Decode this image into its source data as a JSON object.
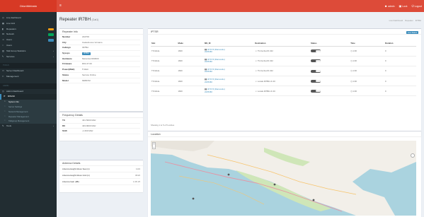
{
  "app": {
    "brand": "OrionWebmin"
  },
  "topnav": [
    {
      "icon": "user-icon",
      "label": "admin"
    },
    {
      "icon": "lock-icon",
      "label": "Lock"
    },
    {
      "icon": "power-icon",
      "label": "Logout"
    }
  ],
  "sidebar": {
    "items": [
      {
        "icon": "dashboard-icon",
        "label": "Live dashboard",
        "badge": "",
        "chevron": ""
      },
      {
        "icon": "grid-icon",
        "label": "Live Grid",
        "badge": "",
        "chevron": ""
      },
      {
        "icon": "radio-icon",
        "label": "Repeaters",
        "badge": "#f39c12",
        "chevron": ""
      },
      {
        "icon": "network-icon",
        "label": "Network",
        "badge": "#00a65a",
        "chevron": ""
      },
      {
        "icon": "users-icon",
        "label": "Users",
        "badge": "#3c8dbc",
        "chevron": ""
      },
      {
        "icon": "circle-icon",
        "label": "Users",
        "badge": "",
        "chevron": ""
      },
      {
        "icon": "bar-chart-icon",
        "label": "Talk Group Statistics",
        "badge": "",
        "chevron": "‹"
      },
      {
        "icon": "bolt-icon",
        "label": "Services",
        "badge": "",
        "chevron": "‹"
      }
    ],
    "header1": "TOOLS",
    "items2": [
      {
        "icon": "monitor-icon",
        "label": "Server Dashboard",
        "badge": ""
      },
      {
        "icon": "tools-icon",
        "label": "Management",
        "badge": ""
      }
    ],
    "header2": "ADMIN",
    "items3": [
      {
        "icon": "dashboard-icon",
        "label": "Admin Dashboard",
        "badge": ""
      }
    ],
    "active": {
      "icon": "repeat-icon",
      "label": "RW210"
    },
    "subitems": [
      {
        "label": "System Info",
        "current": true
      },
      {
        "label": "Server Settings",
        "current": false
      },
      {
        "label": "Network Management",
        "current": false
      },
      {
        "label": "Repeater Management",
        "current": false
      },
      {
        "label": "Talkgroup Management",
        "current": false
      }
    ],
    "last": {
      "icon": "wrench-icon",
      "label": "Tools"
    }
  },
  "page": {
    "title": "Repeater IR7BH",
    "subtitle": "(Cal1)",
    "breadcrumbs": [
      "Live Dashboard",
      "Repeater",
      "IR7BH"
    ]
  },
  "repeater_info": {
    "title": "Repeater Info",
    "rows": [
      {
        "k": "Number",
        "v": "222700",
        "pill": false
      },
      {
        "k": "City",
        "v": "Castelnuovo Vomano",
        "pill": false
      },
      {
        "k": "Callsign",
        "v": "IR7BH",
        "pill": false
      },
      {
        "k": "Sysops",
        "v": "IR7BH",
        "pill": true
      },
      {
        "k": "Hardware",
        "v": "Motorola DR3000",
        "pill": false
      },
      {
        "k": "Firmware",
        "v": "R01.07.00",
        "pill": false
      },
      {
        "k": "Power(Watt)",
        "v": "5 Watt",
        "pill": false
      },
      {
        "k": "Status",
        "v": "Service Online",
        "pill": false
      },
      {
        "k": "Model",
        "v": "MMDVM",
        "pill": false
      }
    ]
  },
  "frequency_details": {
    "title": "Frequency Details",
    "rows": [
      {
        "k": "TX",
        "v": "431.5000 MHz"
      },
      {
        "k": "RX",
        "v": "433.9000 MHz"
      },
      {
        "k": "Shift",
        "v": "-1.600 MHz"
      }
    ]
  },
  "antenna_details": {
    "title": "Antenna Details",
    "rows": [
      {
        "k": "Antenna Height Above Sea (m)",
        "v": "1134"
      },
      {
        "k": "Antenna Height Above Gnd (m)",
        "v": "30/20"
      },
      {
        "k": "Antenna Gain (dBi)",
        "v": "1.0/0.25"
      }
    ]
  },
  "ipsc_table": {
    "title": "IPTSR",
    "button": "Live Status",
    "columns": [
      "Slot",
      "Mode",
      "MS_ID",
      "Destination",
      "Status",
      "Time",
      "Duration"
    ],
    "rows": [
      {
        "slot": "TS Mode",
        "mode": "1600",
        "ms1": "IZ7XYZ (Raimondo)",
        "ms2": "2225460",
        "dest": "TG Ita-Sud D 222",
        "status": "",
        "time": "1:00",
        "dur": "0"
      },
      {
        "slot": "TS Mode",
        "mode": "1600",
        "ms1": "IZ7XYZ (Raimondo)",
        "ms2": "2225460",
        "dest": "TG Ita-Sud D 222",
        "status": "",
        "time": "1:00",
        "dur": "0"
      },
      {
        "slot": "TS Mode",
        "mode": "1600",
        "ms1": "IZ7XYZ (Raimondo)",
        "ms2": "2225460",
        "dest": "TG Ita-Sud D 222",
        "status": "",
        "time": "1:00",
        "dur": "0"
      },
      {
        "slot": "TS Mode",
        "mode": "1600",
        "ms1": "IZ7XYZ (Raimondo)",
        "ms2": "2225460",
        "dest": "Locale IR7BH ch 40",
        "status": "",
        "time": "1:00",
        "dur": "0"
      },
      {
        "slot": "TS Mode",
        "mode": "1600",
        "ms1": "IZ7XYZ (Raimondo)",
        "ms2": "2225460",
        "dest": "Locale IR7BH ch 40",
        "status": "",
        "time": "1:00",
        "dur": "0"
      }
    ],
    "footnote": "Showing 1 to 5 of 5 entries"
  },
  "location": {
    "title": "Location",
    "zoom_in": "+",
    "zoom_out": "−",
    "colors": {
      "sea": "#aad3df",
      "land": "#f2efe9",
      "green": "#cfe6b8"
    }
  }
}
